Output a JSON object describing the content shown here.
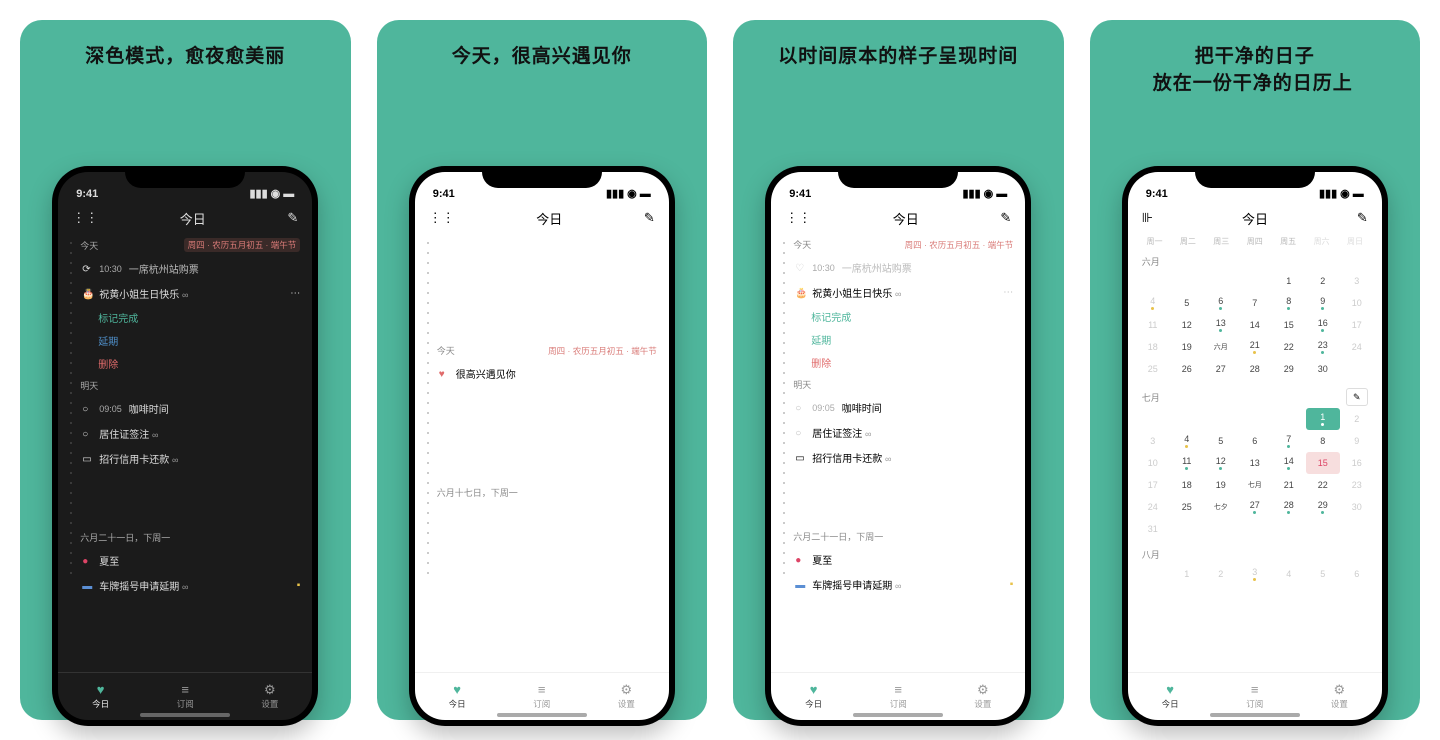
{
  "status_time": "9:41",
  "nav_title": "今日",
  "tabs": {
    "today": "今日",
    "subs": "订阅",
    "settings": "设置"
  },
  "panels": [
    {
      "headline": "深色模式，愈夜愈美丽",
      "today_label": "今天",
      "date_tag": "周四 · 农历五月初五 · 端午节",
      "item_done": {
        "time": "10:30",
        "text": "一席杭州站购票"
      },
      "item_bday": "祝黄小姐生日快乐",
      "menu_done": "标记完成",
      "menu_delay": "延期",
      "menu_del": "删除",
      "tomorrow_label": "明天",
      "t_coffee": {
        "time": "09:05",
        "text": "咖啡时间"
      },
      "t_visa": "居住证签注",
      "t_card": "招行信用卡还款",
      "future_label": "六月二十一日，下周一",
      "f_solstice": "夏至",
      "f_plate": "车牌摇号申请延期"
    },
    {
      "headline": "今天，很高兴遇见你",
      "today_label": "今天",
      "date_tag": "周四 · 农历五月初五 · 端午节",
      "greet": "很高兴遇见你",
      "future_label": "六月十七日，下周一"
    },
    {
      "headline": "以时间原本的样子呈现时间",
      "today_label": "今天",
      "date_tag": "周四 · 农历五月初五 · 端午节",
      "item_done": {
        "time": "10:30",
        "text": "一席杭州站购票"
      },
      "item_bday": "祝黄小姐生日快乐",
      "menu_done": "标记完成",
      "menu_delay": "延期",
      "menu_del": "删除",
      "tomorrow_label": "明天",
      "t_coffee": {
        "time": "09:05",
        "text": "咖啡时间"
      },
      "t_visa": "居住证签注",
      "t_card": "招行信用卡还款",
      "future_label": "六月二十一日，下周一",
      "f_solstice": "夏至",
      "f_plate": "车牌摇号申请延期"
    },
    {
      "headline1": "把干净的日子",
      "headline2": "放在一份干净的日历上",
      "weekdays": [
        "周一",
        "周二",
        "周三",
        "周四",
        "周五",
        "周六",
        "周日"
      ],
      "m1_label": "六月",
      "m1_lunar": "六月",
      "m2_label": "七月",
      "m2_lunar": "七月",
      "m2_qixi": "七夕",
      "m3_label": "八月"
    }
  ]
}
